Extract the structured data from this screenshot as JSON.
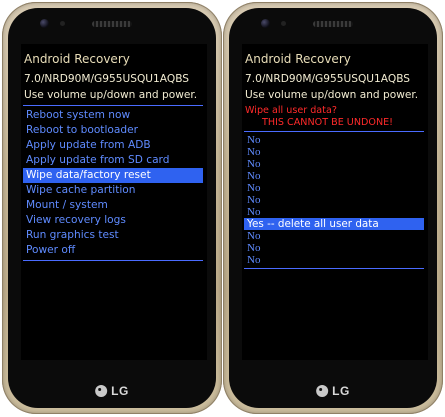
{
  "left_phone": {
    "brand": "LG",
    "screen": {
      "title": "Android Recovery",
      "build": "7.0/NRD90M/G955USQU1AQBS",
      "instruction": "Use volume up/down and power.",
      "menu_items": [
        "Reboot system now",
        "Reboot to bootloader",
        "Apply update from ADB",
        "Apply update from SD card",
        "Wipe data/factory reset",
        "Wipe cache partition",
        "Mount / system",
        "View recovery logs",
        "Run graphics test",
        "Power off"
      ],
      "selected_index": 4
    }
  },
  "right_phone": {
    "brand": "LG",
    "screen": {
      "title": "Android Recovery",
      "build": "7.0/NRD90M/G955USQU1AQBS",
      "instruction": "Use volume up/down and power.",
      "warning_question": "Wipe all user data?",
      "warning_caution": "THIS CANNOT BE UNDONE!",
      "options": [
        "No",
        "No",
        "No",
        "No",
        "No",
        "No",
        "No",
        "Yes -- delete all user data",
        "No",
        "No",
        "No"
      ],
      "selected_index": 7
    }
  },
  "colors": {
    "menu_text": "#5f8bff",
    "highlight": "#2f62f0",
    "separator": "#4a6bff",
    "warning": "#ff2a2a",
    "title": "#e8ddb8"
  },
  "icons": {
    "front_camera": "front-camera-icon",
    "speaker": "speaker-grille-icon",
    "brand_logo": "lg-logo-icon"
  }
}
